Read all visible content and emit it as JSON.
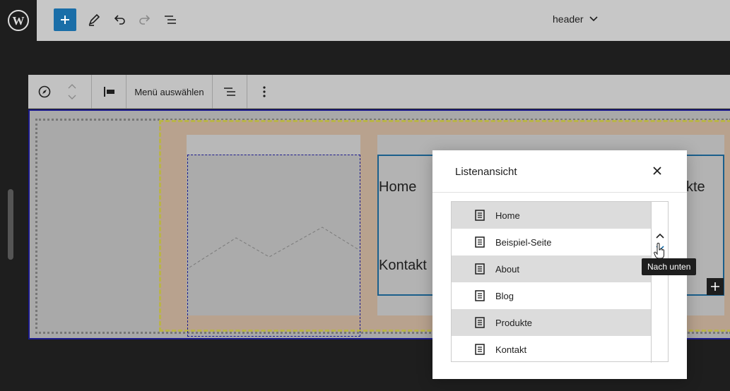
{
  "topbar": {
    "logo_icon": "wordpress-icon",
    "add_icon": "plus-icon",
    "tools_icon": "pen-icon",
    "undo_icon": "undo-icon",
    "redo_icon": "redo-icon",
    "list_view_icon": "list-view-icon",
    "document_title": "header"
  },
  "block_toolbar": {
    "menu_select_label": "Menü auswählen"
  },
  "canvas": {
    "nav_links": [
      "Home",
      "Kontakt",
      "kte"
    ]
  },
  "list_view": {
    "title": "Listenansicht",
    "items": [
      {
        "label": "Home"
      },
      {
        "label": "Beispiel-Seite"
      },
      {
        "label": "About"
      },
      {
        "label": "Blog"
      },
      {
        "label": "Produkte"
      },
      {
        "label": "Kontakt"
      }
    ],
    "tooltip": "Nach unten"
  },
  "colors": {
    "accent": "#1a6ea8",
    "selection": "#1b1a8c"
  }
}
